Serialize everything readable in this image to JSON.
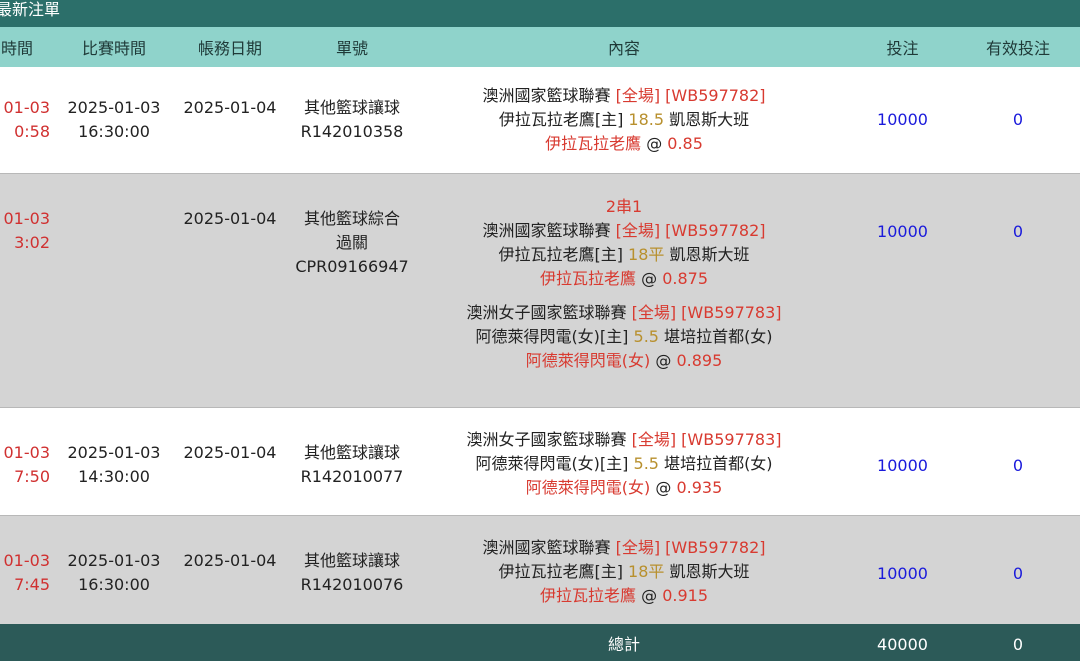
{
  "title": "最新注單",
  "corner_text": " ",
  "headers": {
    "time": "時間",
    "match_time": "比賽時間",
    "account_date": "帳務日期",
    "slip_no": "單號",
    "content": "內容",
    "bet": "投注",
    "valid_bet": "有效投注"
  },
  "rows": [
    {
      "time_date": "01-03",
      "time_clock": "0:58",
      "match_date": "2025-01-03",
      "match_clock": "16:30:00",
      "account_date": "2025-01-04",
      "slip_type": "其他籃球讓球",
      "slip_type2": "",
      "slip_no": "R142010358",
      "parlay_label": "",
      "items": [
        {
          "league": "澳洲國家籃球聯賽",
          "period": "[全場]",
          "code": "[WB597782]",
          "home": "伊拉瓦拉老鷹[主]",
          "line": "18.5",
          "away": "凱恩斯大班",
          "pick": "伊拉瓦拉老鷹",
          "at": "@",
          "odds": "0.85"
        }
      ],
      "bet": "10000",
      "valid": "0"
    },
    {
      "time_date": "01-03",
      "time_clock": "3:02",
      "match_date": "",
      "match_clock": "",
      "account_date": "2025-01-04",
      "slip_type": "其他籃球綜合",
      "slip_type2": "過關",
      "slip_no": "CPR09166947",
      "parlay_label": "2串1",
      "items": [
        {
          "league": "澳洲國家籃球聯賽",
          "period": "[全場]",
          "code": "[WB597782]",
          "home": "伊拉瓦拉老鷹[主]",
          "line": "18平",
          "away": "凱恩斯大班",
          "pick": "伊拉瓦拉老鷹",
          "at": "@",
          "odds": "0.875"
        },
        {
          "league": "澳洲女子國家籃球聯賽",
          "period": "[全場]",
          "code": "[WB597783]",
          "home": "阿德萊得閃電(女)[主]",
          "line": "5.5",
          "away": "堪培拉首都(女)",
          "pick": "阿德萊得閃電(女)",
          "at": "@",
          "odds": "0.895"
        }
      ],
      "bet": "10000",
      "valid": "0"
    },
    {
      "time_date": "01-03",
      "time_clock": "7:50",
      "match_date": "2025-01-03",
      "match_clock": "14:30:00",
      "account_date": "2025-01-04",
      "slip_type": "其他籃球讓球",
      "slip_type2": "",
      "slip_no": "R142010077",
      "parlay_label": "",
      "items": [
        {
          "league": "澳洲女子國家籃球聯賽",
          "period": "[全場]",
          "code": "[WB597783]",
          "home": "阿德萊得閃電(女)[主]",
          "line": "5.5",
          "away": "堪培拉首都(女)",
          "pick": "阿德萊得閃電(女)",
          "at": "@",
          "odds": "0.935"
        }
      ],
      "bet": "10000",
      "valid": "0"
    },
    {
      "time_date": "01-03",
      "time_clock": "7:45",
      "match_date": "2025-01-03",
      "match_clock": "16:30:00",
      "account_date": "2025-01-04",
      "slip_type": "其他籃球讓球",
      "slip_type2": "",
      "slip_no": "R142010076",
      "parlay_label": "",
      "items": [
        {
          "league": "澳洲國家籃球聯賽",
          "period": "[全場]",
          "code": "[WB597782]",
          "home": "伊拉瓦拉老鷹[主]",
          "line": "18平",
          "away": "凱恩斯大班",
          "pick": "伊拉瓦拉老鷹",
          "at": "@",
          "odds": "0.915"
        }
      ],
      "bet": "10000",
      "valid": "0"
    }
  ],
  "total": {
    "label": "總計",
    "bet": "40000",
    "valid": "0"
  },
  "colors": {
    "title_bg": "#2c6f6a",
    "header_bg": "#8fd3cb",
    "footer_bg": "#2c5a58",
    "accent_red": "#d83a30",
    "line_gold": "#b8902e",
    "amount_blue": "#1a1adb"
  }
}
